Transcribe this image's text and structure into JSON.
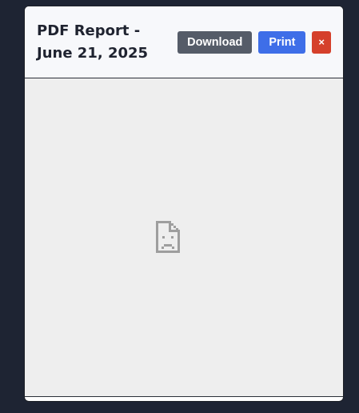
{
  "modal": {
    "title": "PDF Report - June 21, 2025",
    "buttons": {
      "download_label": "Download",
      "print_label": "Print",
      "close_label": "×"
    },
    "viewer": {
      "icon": "broken-document-icon"
    }
  },
  "colors": {
    "page_background": "#1e2433",
    "download_button": "#555c68",
    "print_button": "#3e6ee8",
    "close_button": "#d5402b",
    "viewer_background": "#eeeeee"
  }
}
